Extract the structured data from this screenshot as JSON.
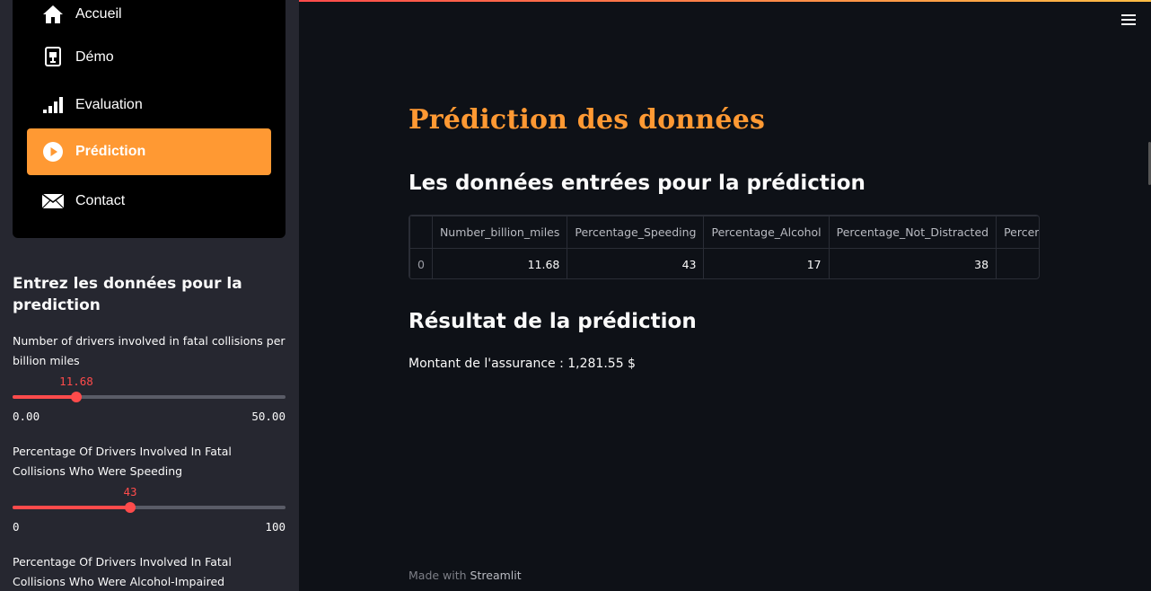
{
  "sidebar": {
    "nav": [
      {
        "label": "Accueil",
        "icon": "home-icon",
        "active": false
      },
      {
        "label": "Démo",
        "icon": "presentation-icon",
        "active": false
      },
      {
        "label": "Evaluation",
        "icon": "bar-chart-icon",
        "active": false
      },
      {
        "label": "Prédiction",
        "icon": "play-circle-icon",
        "active": true
      },
      {
        "label": "Contact",
        "icon": "envelope-icon",
        "active": false
      }
    ],
    "header": "Entrez les données pour la prediction",
    "sliders": [
      {
        "label": "Number of drivers involved in fatal collisions per billion miles",
        "value": "11.68",
        "min": "0.00",
        "max": "50.00",
        "fraction": 0.2336
      },
      {
        "label": "Percentage Of Drivers Involved In Fatal Collisions Who Were Speeding",
        "value": "43",
        "min": "0",
        "max": "100",
        "fraction": 0.43
      },
      {
        "label": "Percentage Of Drivers Involved In Fatal Collisions Who Were Alcohol-Impaired"
      }
    ]
  },
  "main": {
    "title": "Prédiction des données",
    "input_header": "Les données entrées pour la prédiction",
    "table": {
      "columns": [
        "",
        "Number_billion_miles",
        "Percentage_Speeding",
        "Percentage_Alcohol",
        "Percentage_Not_Distracted",
        "Percent"
      ],
      "rows": [
        [
          "0",
          "11.68",
          "43",
          "17",
          "38",
          ""
        ]
      ]
    },
    "result_header": "Résultat de la prédiction",
    "result_text": "Montant de l'assurance : 1,281.55 $",
    "footer_prefix": "Made with ",
    "footer_brand": "Streamlit"
  },
  "colors": {
    "accent": "#ff9933",
    "slider": "#ff4b4b",
    "background": "#0e1117",
    "sidebar": "#262730"
  }
}
